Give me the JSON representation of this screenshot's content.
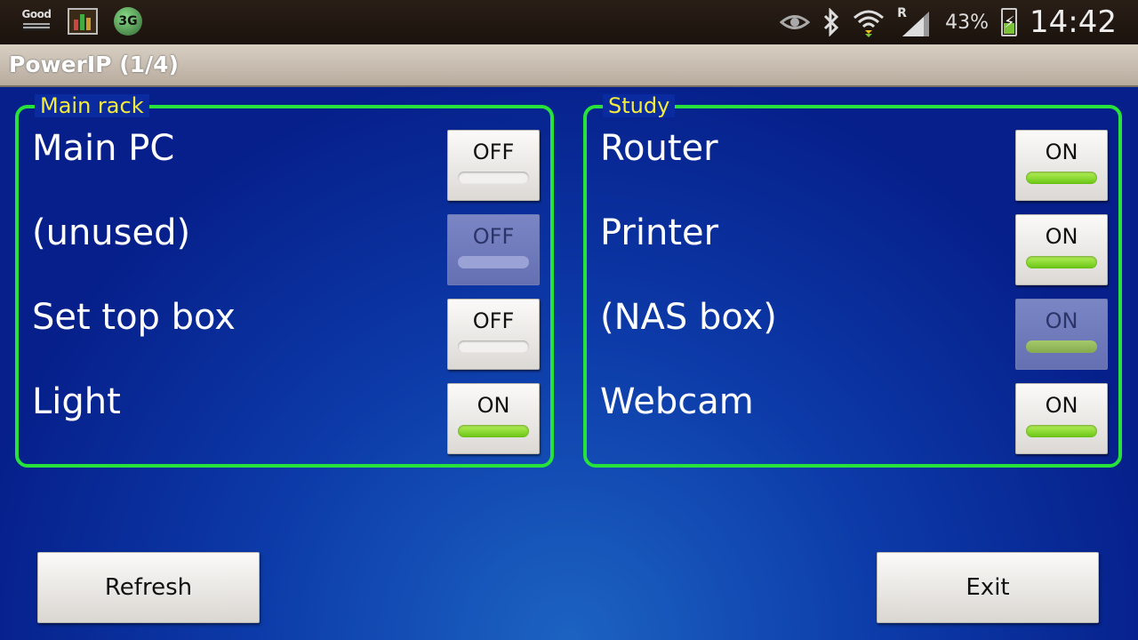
{
  "status_bar": {
    "good_label": "Good",
    "network_label": "3G",
    "roaming_label": "R",
    "battery_percent": "43%",
    "battery_level": 0.43,
    "time": "14:42",
    "icons": [
      "good-icon",
      "chart-icon",
      "3g-icon",
      "eye-icon",
      "bluetooth-icon",
      "wifi-icon",
      "signal-icon",
      "battery-icon"
    ]
  },
  "app": {
    "title": "PowerIP (1/4)"
  },
  "groups": [
    {
      "title": "Main rack",
      "items": [
        {
          "label": "Main PC",
          "state": "OFF",
          "enabled": true
        },
        {
          "label": "(unused)",
          "state": "OFF",
          "enabled": false
        },
        {
          "label": "Set top box",
          "state": "OFF",
          "enabled": true
        },
        {
          "label": "Light",
          "state": "ON",
          "enabled": true
        }
      ]
    },
    {
      "title": "Study",
      "items": [
        {
          "label": "Router",
          "state": "ON",
          "enabled": true
        },
        {
          "label": "Printer",
          "state": "ON",
          "enabled": true
        },
        {
          "label": "(NAS box)",
          "state": "ON",
          "enabled": false
        },
        {
          "label": "Webcam",
          "state": "ON",
          "enabled": true
        }
      ]
    }
  ],
  "buttons": {
    "refresh": "Refresh",
    "exit": "Exit"
  },
  "colors": {
    "group_border": "#27e23a",
    "group_title": "#f4ec3a",
    "on_indicator": "#69c413"
  }
}
